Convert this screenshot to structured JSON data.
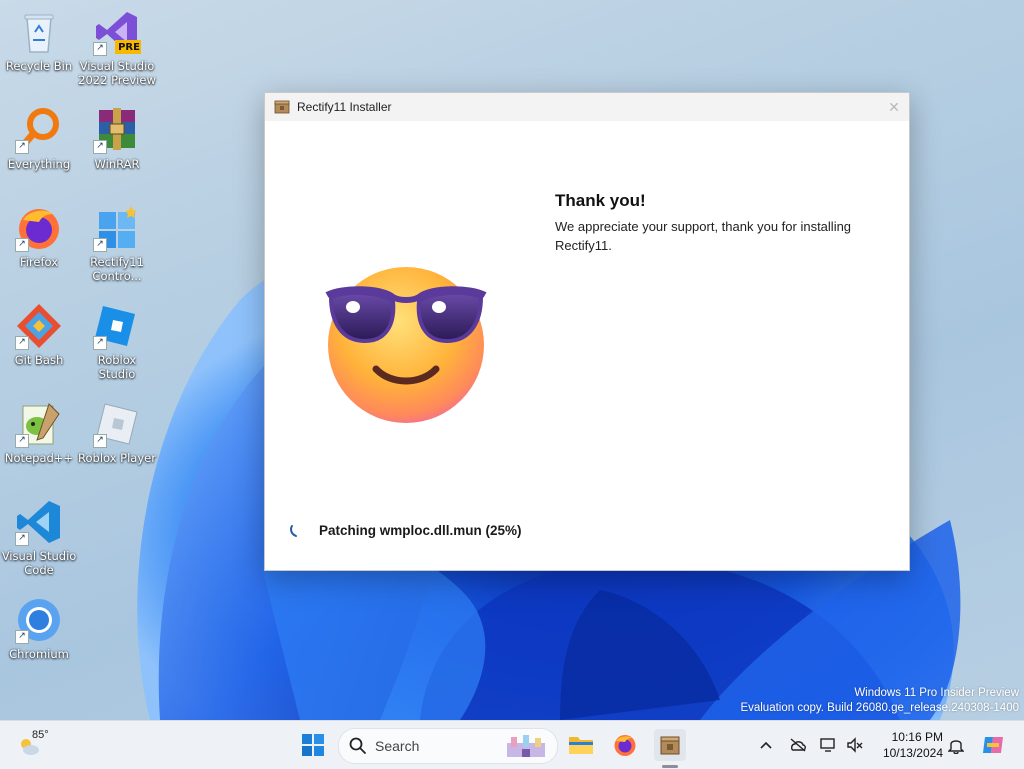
{
  "desktop": {
    "icons": [
      {
        "label": "Recycle Bin",
        "icon": "recycle-bin-icon"
      },
      {
        "label": "Visual Studio 2022 Preview",
        "icon": "visual-studio-icon",
        "badge": "PRE"
      },
      {
        "label": "Everything",
        "icon": "everything-icon"
      },
      {
        "label": "WinRAR",
        "icon": "winrar-icon"
      },
      {
        "label": "Firefox",
        "icon": "firefox-icon"
      },
      {
        "label": "Rectify11 Contro...",
        "icon": "rectify11-control-icon"
      },
      {
        "label": "Git Bash",
        "icon": "git-bash-icon"
      },
      {
        "label": "Roblox Studio",
        "icon": "roblox-studio-icon"
      },
      {
        "label": "Notepad++",
        "icon": "notepad-plus-plus-icon"
      },
      {
        "label": "Roblox Player",
        "icon": "roblox-player-icon"
      },
      {
        "label": "Visual Studio Code",
        "icon": "vscode-icon"
      },
      {
        "label": "Chromium",
        "icon": "chromium-icon"
      }
    ]
  },
  "installer": {
    "title": "Rectify11 Installer",
    "close_glyph": "✕",
    "heading": "Thank you!",
    "message": "We appreciate your support, thank you for installing Rectify11.",
    "status": "Patching wmploc.dll.mun (25%)",
    "progress_percent": 25
  },
  "watermark": {
    "line1": "Windows 11 Pro Insider Preview",
    "line2": "Evaluation copy. Build 26080.ge_release.240308-1400"
  },
  "taskbar": {
    "weather_temp": "85°",
    "search_placeholder": "Search",
    "pinned": [
      "start-icon",
      "file-explorer-icon",
      "firefox-icon",
      "rectify11-installer-icon"
    ],
    "time": "10:16 PM",
    "date": "10/13/2024"
  },
  "colors": {
    "accent": "#0067c0",
    "window_bg": "#ffffff",
    "taskbar_bg": "#eef2f6"
  }
}
